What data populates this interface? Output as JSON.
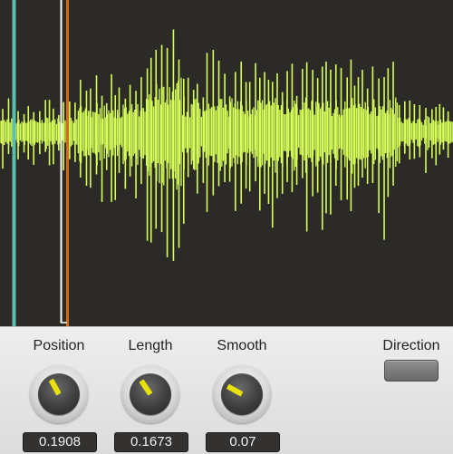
{
  "colors": {
    "waveform": "#d6ff5a",
    "background": "#2b2a26",
    "cursor_cyan": "#5bbfb0",
    "cursor_white": "#ffffff",
    "cursor_orange": "#d26a1a",
    "knob_pointer": "#e8e20a"
  },
  "controls": [
    {
      "label": "Position",
      "value": "0.1908",
      "level": 0.19
    },
    {
      "label": "Length",
      "value": "0.1673",
      "level": 0.17
    },
    {
      "label": "Smooth",
      "value": "0.07",
      "level": 0.07
    }
  ],
  "direction": {
    "label": "Direction"
  }
}
